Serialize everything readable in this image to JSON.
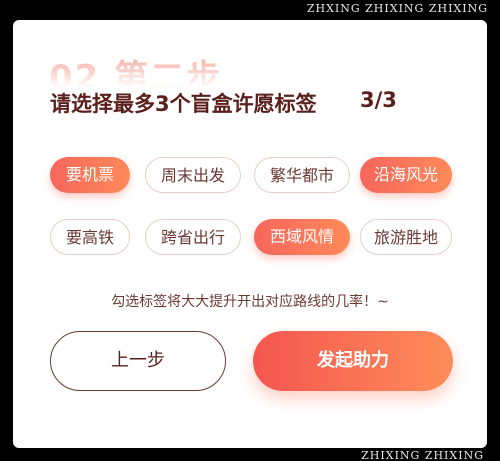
{
  "watermark_top": "ZHXING ZHIXING ZHIXING",
  "watermark_bottom": "ZHIXING ZHIXING",
  "ghost_step": "02 第二步",
  "headline": "请选择最多3个盲盒许愿标签",
  "selection_count": "3/3",
  "tags": [
    {
      "label": "要机票",
      "selected": true
    },
    {
      "label": "周末出发",
      "selected": false
    },
    {
      "label": "繁华都市",
      "selected": false
    },
    {
      "label": "沿海风光",
      "selected": true
    },
    {
      "label": "要高铁",
      "selected": false
    },
    {
      "label": "跨省出行",
      "selected": false
    },
    {
      "label": "西域风情",
      "selected": true
    },
    {
      "label": "旅游胜地",
      "selected": false
    }
  ],
  "hint": "勾选标签将大大提升开出对应路线的几率！~",
  "buttons": {
    "prev": "上一步",
    "submit": "发起助力"
  },
  "colors": {
    "accent_start": "#f4564f",
    "accent_end": "#ff8d5a",
    "text_dark": "#5a1f1a"
  }
}
